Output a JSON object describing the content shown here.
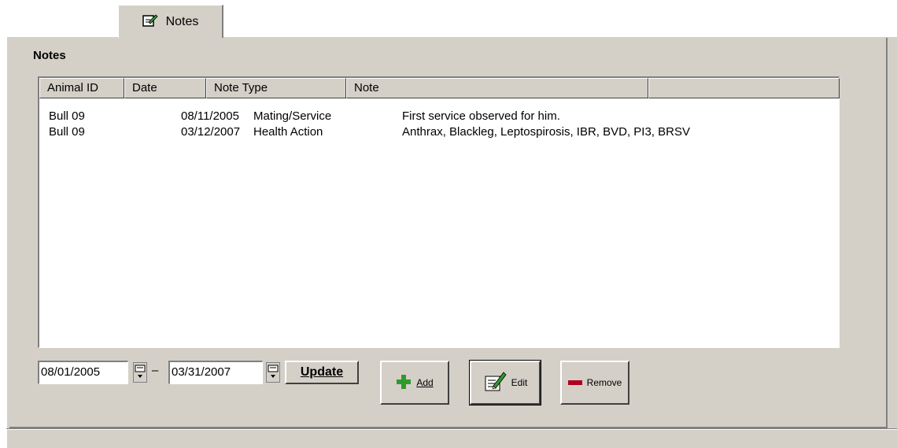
{
  "tab": {
    "label": "Notes",
    "icon": "notepad-icon"
  },
  "section": {
    "title": "Notes"
  },
  "table": {
    "columns": [
      "Animal ID",
      "Date",
      "Note Type",
      "Note",
      ""
    ],
    "rows": [
      {
        "animal_id": "Bull 09",
        "date": "08/11/2005",
        "note_type": "Mating/Service",
        "note": "First service observed for him."
      },
      {
        "animal_id": "Bull 09",
        "date": "03/12/2007",
        "note_type": "Health Action",
        "note": "Anthrax, Blackleg, Leptospirosis, IBR, BVD, PI3, BRSV"
      }
    ]
  },
  "filter": {
    "from_date": "08/01/2005",
    "separator": "–",
    "to_date": "03/31/2007",
    "update_label": "Update"
  },
  "buttons": {
    "add_label": "Add",
    "edit_label": "Edit",
    "remove_label": "Remove"
  },
  "colors": {
    "face": "#d4d0c8",
    "add_green": "#2e9a2e",
    "remove_red": "#b00020"
  }
}
